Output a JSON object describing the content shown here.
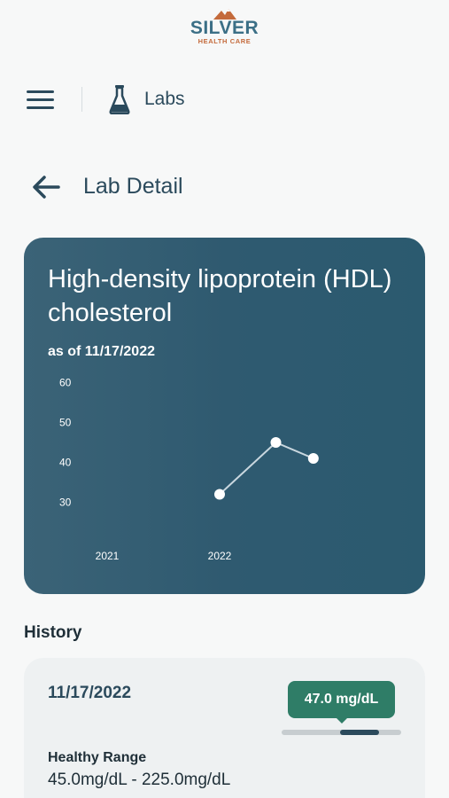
{
  "logo": {
    "word": "SILVER",
    "subtitle": "HEALTH CARE"
  },
  "nav": {
    "title": "Labs"
  },
  "page": {
    "title": "Lab Detail"
  },
  "card": {
    "title": "High-density lipoprotein (HDL) cholesterol",
    "as_of": "as of 11/17/2022"
  },
  "chart_data": {
    "type": "line",
    "y_ticks": [
      "60",
      "50",
      "40",
      "30"
    ],
    "x_ticks": [
      "2021",
      "2022"
    ],
    "ylim": [
      23,
      63
    ],
    "grid": false,
    "series": [
      {
        "x": [
          "2022-01",
          "2022-07",
          "2022-11"
        ],
        "values": [
          32,
          45,
          41
        ]
      }
    ]
  },
  "history": {
    "label": "History",
    "items": [
      {
        "date": "11/17/2022",
        "value": "47.0 mg/dL",
        "range_position": 0.65,
        "healthy_range_label": "Healthy Range",
        "healthy_range_value": "45.0mg/dL - 225.0mg/dL"
      }
    ]
  },
  "colors": {
    "card_bg": "#2f5a70",
    "badge": "#2f7d67",
    "text": "#2b4a5c",
    "logo_blue": "#3b6f86",
    "logo_orange": "#c46a3b"
  }
}
